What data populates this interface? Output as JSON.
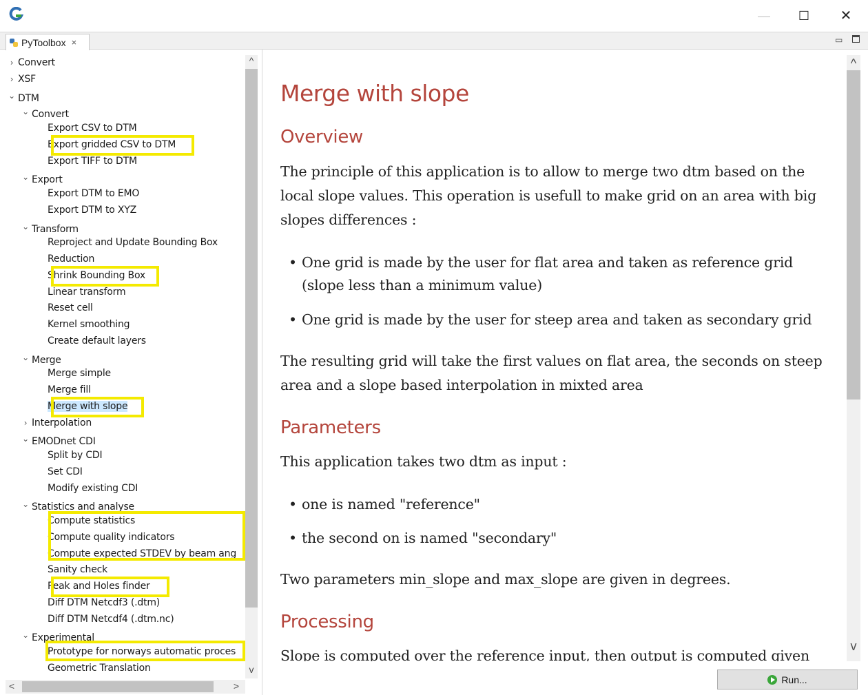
{
  "window": {
    "controls": {
      "minimize": "—",
      "maximize": "☐",
      "close": "✕"
    }
  },
  "tab": {
    "label": "PyToolbox",
    "close": "×"
  },
  "tree": {
    "rows": [
      {
        "label": "Convert",
        "twisty": ">"
      },
      {
        "label": "XSF",
        "twisty": ">"
      },
      {
        "label": "DTM",
        "twisty": "v"
      },
      {
        "label": "Convert",
        "twisty": "v"
      },
      {
        "label": "Export CSV to DTM",
        "twisty": ""
      },
      {
        "label": "Export gridded CSV to DTM",
        "twisty": ""
      },
      {
        "label": "Export TIFF to DTM",
        "twisty": ""
      },
      {
        "label": "Export",
        "twisty": "v"
      },
      {
        "label": "Export DTM to EMO",
        "twisty": ""
      },
      {
        "label": "Export DTM to XYZ",
        "twisty": ""
      },
      {
        "label": "Transform",
        "twisty": "v"
      },
      {
        "label": "Reproject and Update Bounding Box",
        "twisty": ""
      },
      {
        "label": "Reduction",
        "twisty": ""
      },
      {
        "label": "Shrink Bounding Box",
        "twisty": ""
      },
      {
        "label": "Linear transform",
        "twisty": ""
      },
      {
        "label": "Reset cell",
        "twisty": ""
      },
      {
        "label": "Kernel smoothing",
        "twisty": ""
      },
      {
        "label": "Create default layers",
        "twisty": ""
      },
      {
        "label": "Merge",
        "twisty": "v"
      },
      {
        "label": "Merge simple",
        "twisty": ""
      },
      {
        "label": "Merge fill",
        "twisty": ""
      },
      {
        "label": "Merge with slope",
        "twisty": ""
      },
      {
        "label": "Interpolation",
        "twisty": ">"
      },
      {
        "label": "EMODnet CDI",
        "twisty": "v"
      },
      {
        "label": "Split by CDI",
        "twisty": ""
      },
      {
        "label": "Set CDI",
        "twisty": ""
      },
      {
        "label": "Modify existing CDI",
        "twisty": ""
      },
      {
        "label": "Statistics and analyse",
        "twisty": "v"
      },
      {
        "label": "Compute statistics",
        "twisty": ""
      },
      {
        "label": "Compute quality indicators",
        "twisty": ""
      },
      {
        "label": "Compute expected STDEV by beam ang",
        "twisty": ""
      },
      {
        "label": "Sanity check",
        "twisty": ""
      },
      {
        "label": "Peak and Holes finder",
        "twisty": ""
      },
      {
        "label": "Diff DTM Netcdf3 (.dtm)",
        "twisty": ""
      },
      {
        "label": "Diff DTM Netcdf4 (.dtm.nc)",
        "twisty": ""
      },
      {
        "label": "Experimental",
        "twisty": "v"
      },
      {
        "label": "Prototype for norways automatic proces",
        "twisty": ""
      },
      {
        "label": "Geometric Translation",
        "twisty": ""
      }
    ]
  },
  "doc": {
    "title": "Merge with slope",
    "overview_heading": "Overview",
    "overview_p1": "The principle of this application is to allow to merge two dtm based on the local slope values. This operation is usefull to make grid on an area with big slopes differences :",
    "bullet1": "One grid is made by the user for flat area and taken as reference grid (slope less than a minimum value)",
    "bullet2": "One grid is made by the user for steep area and taken as secondary grid",
    "overview_p2": "The resulting grid will take the first values on flat area, the seconds on steep area and a slope based interpolation in mixted area",
    "parameters_heading": "Parameters",
    "parameters_p1": "This application takes two dtm as input :",
    "bullet3": "one is named \"reference\"",
    "bullet4": "the second on is named \"secondary\"",
    "parameters_p2": "Two parameters min_slope and max_slope are given in degrees.",
    "processing_heading": "Processing",
    "processing_p1": "Slope is computed over the reference input, then output is computed given the"
  },
  "run_button": {
    "label": "Run..."
  },
  "colors": {
    "heading": "#b4453c",
    "highlight": "#f4ea00",
    "selection": "#cce8ff"
  }
}
